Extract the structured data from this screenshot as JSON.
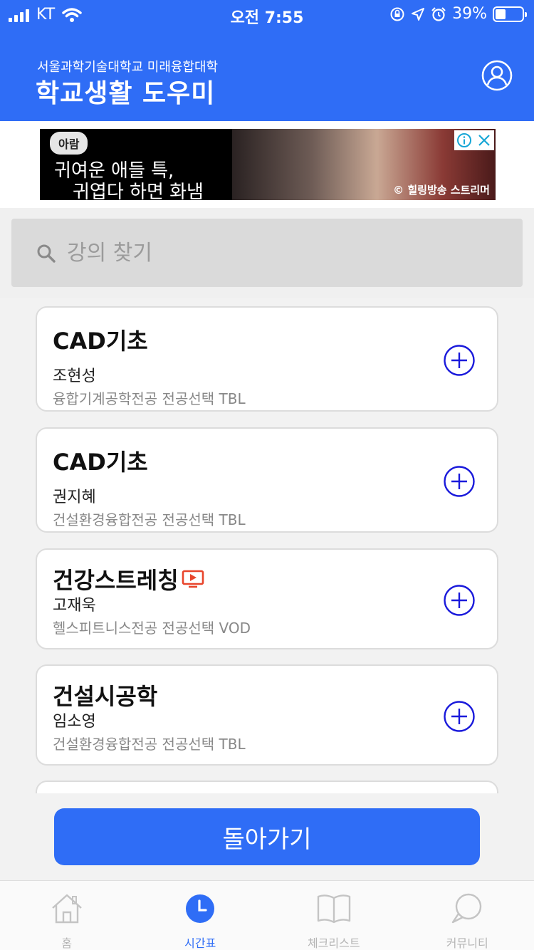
{
  "status_bar": {
    "carrier": "KT",
    "time": "오전 7:55",
    "battery_percent": "39%",
    "battery_level": 0.39
  },
  "header": {
    "subtitle": "서울과학기술대학교 미래융합대학",
    "title": "학교생활 도우미",
    "profile_icon": "user-circle-icon"
  },
  "ad": {
    "badge": "아람",
    "line1": "귀여운 애들 특,",
    "line2": "귀엽다 하면 화냄",
    "credit": "© 힐링방송 스트리머",
    "info_icon": "info-icon",
    "close_icon": "close-icon"
  },
  "search": {
    "placeholder": "강의 찾기",
    "value": ""
  },
  "courses": [
    {
      "name": "CAD기초",
      "professor": "조현성",
      "meta": "융합기계공학전공 전공선택 TBL",
      "vod_icon": false
    },
    {
      "name": "CAD기초",
      "professor": "권지혜",
      "meta": "건설환경융합전공 전공선택 TBL",
      "vod_icon": false
    },
    {
      "name": "건강스트레칭",
      "professor": "고재욱",
      "meta": "헬스피트니스전공 전공선택 VOD",
      "vod_icon": true
    },
    {
      "name": "건설시공학",
      "professor": "임소영",
      "meta": "건설환경융합전공 전공선택 TBL",
      "vod_icon": false
    }
  ],
  "back_button": {
    "label": "돌아가기"
  },
  "tabs": [
    {
      "label": "홈",
      "icon": "home-icon",
      "active": false
    },
    {
      "label": "시간표",
      "icon": "clock-icon",
      "active": true
    },
    {
      "label": "체크리스트",
      "icon": "book-icon",
      "active": false
    },
    {
      "label": "커뮤니티",
      "icon": "chat-icon",
      "active": false
    }
  ],
  "colors": {
    "primary": "#2f6df6",
    "add_icon": "#1a1adb",
    "vod_icon": "#e8452c",
    "inactive_tab": "#b5b5b5"
  }
}
